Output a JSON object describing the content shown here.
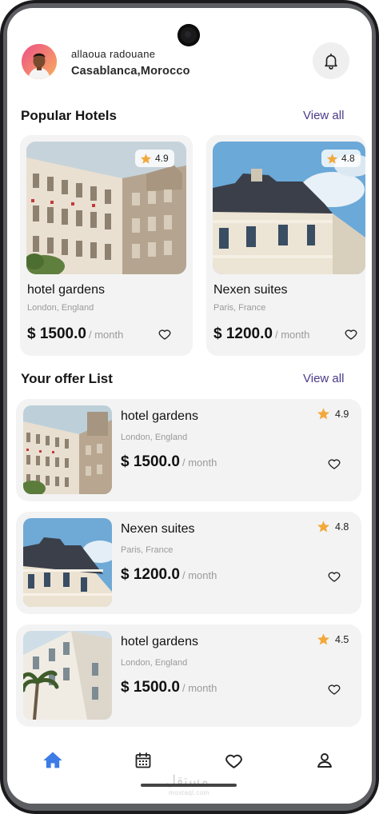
{
  "user": {
    "name": "allaoua radouane",
    "location": "Casablanca,Morocco"
  },
  "icons": {
    "notifications": "bell-icon",
    "rating": "star-icon",
    "favorite": "heart-icon",
    "nav_home": "home-icon",
    "nav_bookings": "calendar-icon",
    "nav_favorites": "heart-icon",
    "nav_profile": "user-icon"
  },
  "popular": {
    "title": "Popular Hotels",
    "view_all": "View all",
    "items": [
      {
        "name": "hotel gardens",
        "location": "London, England",
        "price": "$ 1500.0",
        "period": "/ month",
        "rating": "4.9"
      },
      {
        "name": "Nexen suites",
        "location": "Paris, France",
        "price": "$ 1200.0",
        "period": "/ month",
        "rating": "4.8"
      }
    ]
  },
  "offers": {
    "title": "Your offer List",
    "view_all": "View all",
    "items": [
      {
        "name": "hotel gardens",
        "location": "London, England",
        "price": "$ 1500.0",
        "period": "/ month",
        "rating": "4.9"
      },
      {
        "name": "Nexen suites",
        "location": "Paris, France",
        "price": "$ 1200.0",
        "period": "/ month",
        "rating": "4.8"
      },
      {
        "name": "hotel gardens",
        "location": "London, England",
        "price": "$ 1500.0",
        "period": "/ month",
        "rating": "4.5"
      }
    ]
  },
  "bottom_nav": {
    "active": "home",
    "items": [
      "home",
      "bookings",
      "favorites",
      "profile"
    ]
  },
  "colors": {
    "accent": "#4b3a8a",
    "nav_active": "#3d7be6",
    "star": "#f2a93b",
    "card_bg": "#f3f3f3"
  },
  "watermark": {
    "text": "مستقل",
    "sub": "mostaql.com"
  }
}
